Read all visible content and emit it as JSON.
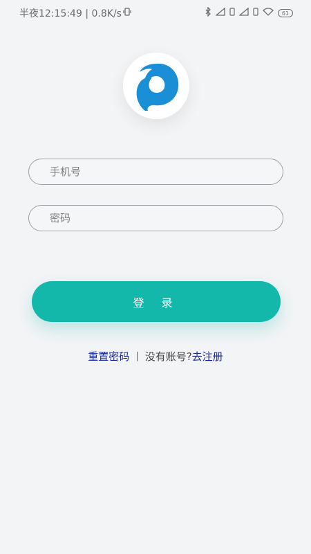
{
  "statusbar": {
    "left_text": "半夜12:15:49 | 0.8K/s",
    "battery": "61",
    "icons": [
      "vibrate-icon",
      "bluetooth-icon",
      "signal-icon",
      "sim-icon",
      "signal-icon",
      "sim-icon",
      "wifi-icon",
      "battery-icon"
    ]
  },
  "logo": {
    "icon": "spiral-logo-icon",
    "color": "#1a8fd6"
  },
  "form": {
    "phone_placeholder": "手机号",
    "password_placeholder": "密码"
  },
  "login_button": {
    "label": "登 录",
    "color": "#13b8ab"
  },
  "links": {
    "reset_password": "重置密码",
    "separator": "|",
    "no_account": "没有账号?",
    "register": "去注册"
  }
}
